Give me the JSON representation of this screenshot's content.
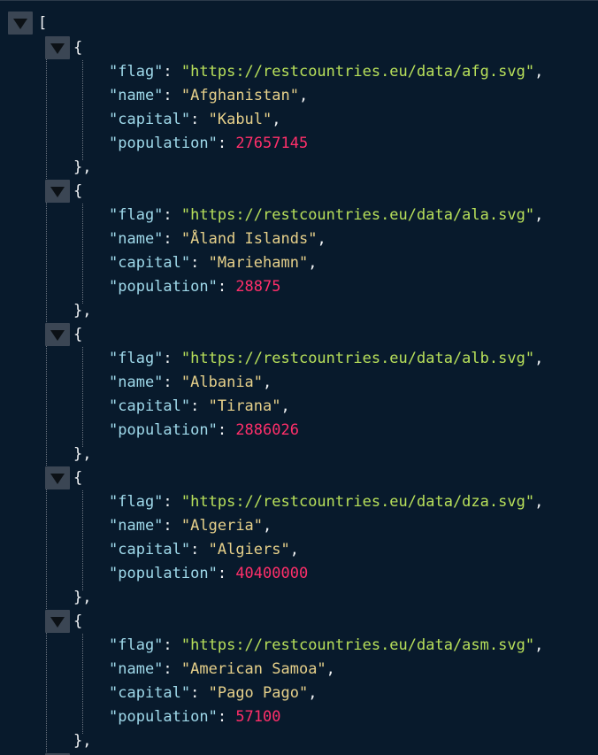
{
  "viewer": {
    "open_bracket": "[",
    "items": [
      {
        "flag": "https://restcountries.eu/data/afg.svg",
        "name": "Afghanistan",
        "capital": "Kabul",
        "population": "27657145"
      },
      {
        "flag": "https://restcountries.eu/data/ala.svg",
        "name": "Åland Islands",
        "capital": "Mariehamn",
        "population": "28875"
      },
      {
        "flag": "https://restcountries.eu/data/alb.svg",
        "name": "Albania",
        "capital": "Tirana",
        "population": "2886026"
      },
      {
        "flag": "https://restcountries.eu/data/dza.svg",
        "name": "Algeria",
        "capital": "Algiers",
        "population": "40400000"
      },
      {
        "flag": "https://restcountries.eu/data/asm.svg",
        "name": "American Samoa",
        "capital": "Pago Pago",
        "population": "57100"
      }
    ],
    "keys": {
      "flag": "\"flag\"",
      "name": "\"name\"",
      "capital": "\"capital\"",
      "population": "\"population\""
    }
  },
  "colors": {
    "background": "#081a2c",
    "key": "#9fd9ea",
    "url_string": "#b8e05a",
    "string": "#e6d08a",
    "number": "#ff2f6a"
  }
}
